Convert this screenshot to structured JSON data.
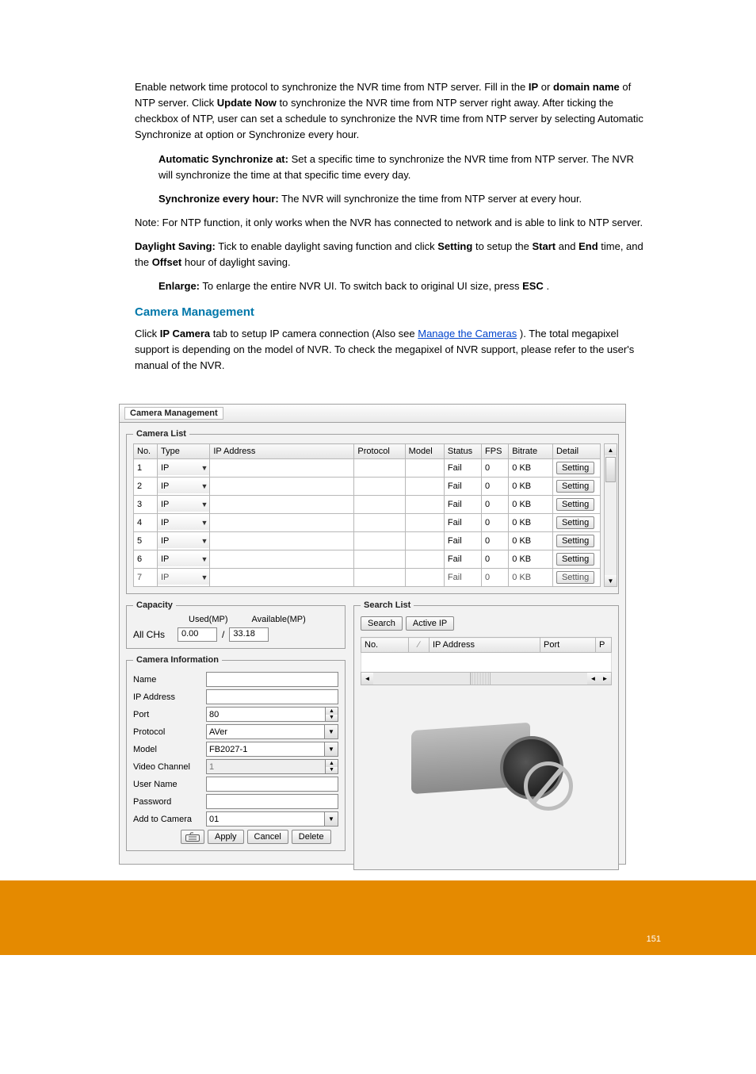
{
  "prose": {
    "p1_a": "Enable network time protocol to synchronize the NVR time from NTP server. Fill in the ",
    "p1_b": "IP",
    "p1_c": " or ",
    "p1_d": "domain name",
    "p1_e": " of NTP server. Click ",
    "p1_f": "Update Now",
    "p1_g": " to synchronize the NVR time from NTP server right away. After ticking the checkbox of NTP, user can set a schedule to synchronize the NVR time from NTP server by selecting Automatic Synchronize at option or Synchronize every hour.",
    "bullet1_a": "Automatic Synchronize at:",
    "bullet1_b": " Set a specific time to synchronize the NVR time from NTP server. The NVR will synchronize the time at that specific time every day.",
    "bullet2_a": "Synchronize every hour:",
    "bullet2_b": " The NVR will synchronize the time from NTP server at every hour.",
    "note": "Note: For NTP function, it only works when the NVR has connected to network and is able to link to NTP server.",
    "p2_a": "Daylight Saving:",
    "p2_b": " Tick to enable daylight saving function and click ",
    "p2_c": "Setting",
    "p2_d": " to setup the ",
    "p2_e": "Start",
    "p2_f": " and ",
    "p2_g": "End",
    "p2_h": " time, and the ",
    "p2_i": "Offset",
    "p2_j": " hour of daylight saving.",
    "enlarge_a": "Enlarge:",
    "enlarge_b": " To enlarge the entire NVR UI. To switch back to original UI size, press ",
    "enlarge_c": "ESC",
    "enlarge_d": ".",
    "section_title": "Camera Management",
    "p3_a": "Click ",
    "p3_b": "IP Camera",
    "p3_c": " tab to setup IP camera connection (Also see ",
    "p3_link": "Manage the Cameras",
    "p3_d": "). The total megapixel support is depending on the model of NVR. To check the megapixel of NVR support, please refer to the user's manual of the NVR."
  },
  "dialog": {
    "title": "Camera Management",
    "camera_list": {
      "legend": "Camera List",
      "headers": {
        "no": "No.",
        "type": "Type",
        "ip": "IP Address",
        "protocol": "Protocol",
        "model": "Model",
        "status": "Status",
        "fps": "FPS",
        "bitrate": "Bitrate",
        "detail": "Detail"
      },
      "rows": [
        {
          "no": "1",
          "type": "IP",
          "status": "Fail",
          "fps": "0",
          "bitrate": "0 KB",
          "detail": "Setting"
        },
        {
          "no": "2",
          "type": "IP",
          "status": "Fail",
          "fps": "0",
          "bitrate": "0 KB",
          "detail": "Setting"
        },
        {
          "no": "3",
          "type": "IP",
          "status": "Fail",
          "fps": "0",
          "bitrate": "0 KB",
          "detail": "Setting"
        },
        {
          "no": "4",
          "type": "IP",
          "status": "Fail",
          "fps": "0",
          "bitrate": "0 KB",
          "detail": "Setting"
        },
        {
          "no": "5",
          "type": "IP",
          "status": "Fail",
          "fps": "0",
          "bitrate": "0 KB",
          "detail": "Setting"
        },
        {
          "no": "6",
          "type": "IP",
          "status": "Fail",
          "fps": "0",
          "bitrate": "0 KB",
          "detail": "Setting"
        },
        {
          "no": "7",
          "type": "IP",
          "status": "Fail",
          "fps": "0",
          "bitrate": "0 KB",
          "detail": "Setting"
        }
      ]
    },
    "capacity": {
      "legend": "Capacity",
      "used_lbl": "Used(MP)",
      "avail_lbl": "Available(MP)",
      "all_chs": "All CHs",
      "used_val": "0.00",
      "avail_val": "33.18",
      "slash": "/"
    },
    "camera_info": {
      "legend": "Camera Information",
      "name_lbl": "Name",
      "ip_lbl": "IP Address",
      "port_lbl": "Port",
      "port_val": "80",
      "protocol_lbl": "Protocol",
      "protocol_val": "AVer",
      "model_lbl": "Model",
      "model_val": "FB2027-1",
      "video_channel_lbl": "Video Channel",
      "video_channel_val": "1",
      "user_lbl": "User Name",
      "pass_lbl": "Password",
      "add_lbl": "Add to Camera",
      "add_val": "01",
      "apply": "Apply",
      "cancel": "Cancel",
      "delete": "Delete"
    },
    "search_list": {
      "legend": "Search List",
      "search_btn": "Search",
      "active_ip_btn": "Active IP",
      "headers": {
        "no": "No.",
        "ip": "IP Address",
        "port": "Port",
        "p": "P"
      }
    }
  },
  "footer": {
    "page": "151"
  }
}
